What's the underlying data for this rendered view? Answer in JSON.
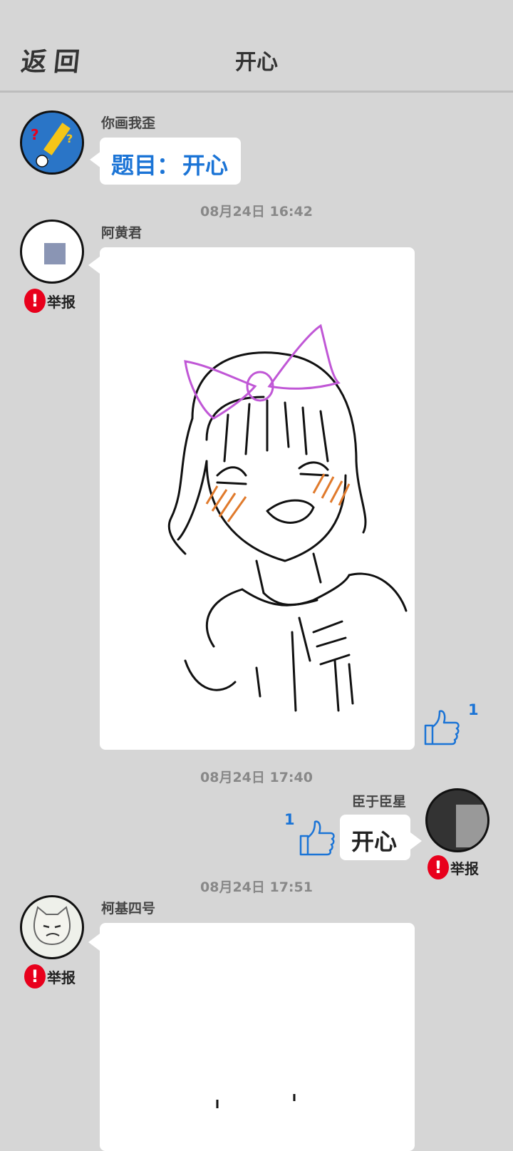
{
  "header": {
    "back_label": "返回",
    "title": "开心"
  },
  "messages": [
    {
      "user": "你画我歪",
      "text_prefix": "题目：",
      "text_topic": "开心"
    },
    {
      "time": "08月24日 16:42",
      "user": "阿黄君",
      "report": "举报",
      "likes": "1"
    },
    {
      "time": "08月24日 17:40",
      "user": "臣于臣星",
      "text": "开心",
      "report": "举报",
      "likes": "1"
    },
    {
      "time": "08月24日 17:51",
      "user": "柯基四号",
      "report": "举报"
    }
  ],
  "icons": {
    "report": "exclamation-icon",
    "like": "thumbs-up-icon"
  },
  "colors": {
    "accent": "#1b74d6",
    "report": "#e8001c",
    "bg": "#d6d6d6"
  }
}
